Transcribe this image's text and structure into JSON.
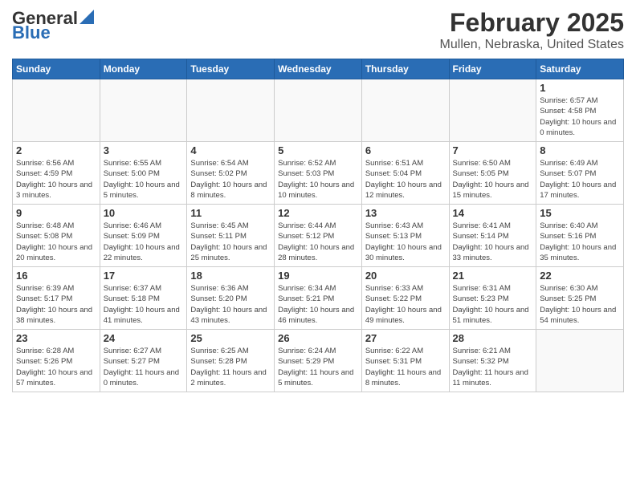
{
  "header": {
    "title": "February 2025",
    "subtitle": "Mullen, Nebraska, United States"
  },
  "days": [
    "Sunday",
    "Monday",
    "Tuesday",
    "Wednesday",
    "Thursday",
    "Friday",
    "Saturday"
  ],
  "weeks": [
    [
      {
        "num": "",
        "info": "",
        "empty": true
      },
      {
        "num": "",
        "info": "",
        "empty": true
      },
      {
        "num": "",
        "info": "",
        "empty": true
      },
      {
        "num": "",
        "info": "",
        "empty": true
      },
      {
        "num": "",
        "info": "",
        "empty": true
      },
      {
        "num": "",
        "info": "",
        "empty": true
      },
      {
        "num": "1",
        "info": "Sunrise: 6:57 AM\nSunset: 4:58 PM\nDaylight: 10 hours\nand 0 minutes.",
        "empty": false
      }
    ],
    [
      {
        "num": "2",
        "info": "Sunrise: 6:56 AM\nSunset: 4:59 PM\nDaylight: 10 hours\nand 3 minutes.",
        "empty": false
      },
      {
        "num": "3",
        "info": "Sunrise: 6:55 AM\nSunset: 5:00 PM\nDaylight: 10 hours\nand 5 minutes.",
        "empty": false
      },
      {
        "num": "4",
        "info": "Sunrise: 6:54 AM\nSunset: 5:02 PM\nDaylight: 10 hours\nand 8 minutes.",
        "empty": false
      },
      {
        "num": "5",
        "info": "Sunrise: 6:52 AM\nSunset: 5:03 PM\nDaylight: 10 hours\nand 10 minutes.",
        "empty": false
      },
      {
        "num": "6",
        "info": "Sunrise: 6:51 AM\nSunset: 5:04 PM\nDaylight: 10 hours\nand 12 minutes.",
        "empty": false
      },
      {
        "num": "7",
        "info": "Sunrise: 6:50 AM\nSunset: 5:05 PM\nDaylight: 10 hours\nand 15 minutes.",
        "empty": false
      },
      {
        "num": "8",
        "info": "Sunrise: 6:49 AM\nSunset: 5:07 PM\nDaylight: 10 hours\nand 17 minutes.",
        "empty": false
      }
    ],
    [
      {
        "num": "9",
        "info": "Sunrise: 6:48 AM\nSunset: 5:08 PM\nDaylight: 10 hours\nand 20 minutes.",
        "empty": false
      },
      {
        "num": "10",
        "info": "Sunrise: 6:46 AM\nSunset: 5:09 PM\nDaylight: 10 hours\nand 22 minutes.",
        "empty": false
      },
      {
        "num": "11",
        "info": "Sunrise: 6:45 AM\nSunset: 5:11 PM\nDaylight: 10 hours\nand 25 minutes.",
        "empty": false
      },
      {
        "num": "12",
        "info": "Sunrise: 6:44 AM\nSunset: 5:12 PM\nDaylight: 10 hours\nand 28 minutes.",
        "empty": false
      },
      {
        "num": "13",
        "info": "Sunrise: 6:43 AM\nSunset: 5:13 PM\nDaylight: 10 hours\nand 30 minutes.",
        "empty": false
      },
      {
        "num": "14",
        "info": "Sunrise: 6:41 AM\nSunset: 5:14 PM\nDaylight: 10 hours\nand 33 minutes.",
        "empty": false
      },
      {
        "num": "15",
        "info": "Sunrise: 6:40 AM\nSunset: 5:16 PM\nDaylight: 10 hours\nand 35 minutes.",
        "empty": false
      }
    ],
    [
      {
        "num": "16",
        "info": "Sunrise: 6:39 AM\nSunset: 5:17 PM\nDaylight: 10 hours\nand 38 minutes.",
        "empty": false
      },
      {
        "num": "17",
        "info": "Sunrise: 6:37 AM\nSunset: 5:18 PM\nDaylight: 10 hours\nand 41 minutes.",
        "empty": false
      },
      {
        "num": "18",
        "info": "Sunrise: 6:36 AM\nSunset: 5:20 PM\nDaylight: 10 hours\nand 43 minutes.",
        "empty": false
      },
      {
        "num": "19",
        "info": "Sunrise: 6:34 AM\nSunset: 5:21 PM\nDaylight: 10 hours\nand 46 minutes.",
        "empty": false
      },
      {
        "num": "20",
        "info": "Sunrise: 6:33 AM\nSunset: 5:22 PM\nDaylight: 10 hours\nand 49 minutes.",
        "empty": false
      },
      {
        "num": "21",
        "info": "Sunrise: 6:31 AM\nSunset: 5:23 PM\nDaylight: 10 hours\nand 51 minutes.",
        "empty": false
      },
      {
        "num": "22",
        "info": "Sunrise: 6:30 AM\nSunset: 5:25 PM\nDaylight: 10 hours\nand 54 minutes.",
        "empty": false
      }
    ],
    [
      {
        "num": "23",
        "info": "Sunrise: 6:28 AM\nSunset: 5:26 PM\nDaylight: 10 hours\nand 57 minutes.",
        "empty": false
      },
      {
        "num": "24",
        "info": "Sunrise: 6:27 AM\nSunset: 5:27 PM\nDaylight: 11 hours\nand 0 minutes.",
        "empty": false
      },
      {
        "num": "25",
        "info": "Sunrise: 6:25 AM\nSunset: 5:28 PM\nDaylight: 11 hours\nand 2 minutes.",
        "empty": false
      },
      {
        "num": "26",
        "info": "Sunrise: 6:24 AM\nSunset: 5:29 PM\nDaylight: 11 hours\nand 5 minutes.",
        "empty": false
      },
      {
        "num": "27",
        "info": "Sunrise: 6:22 AM\nSunset: 5:31 PM\nDaylight: 11 hours\nand 8 minutes.",
        "empty": false
      },
      {
        "num": "28",
        "info": "Sunrise: 6:21 AM\nSunset: 5:32 PM\nDaylight: 11 hours\nand 11 minutes.",
        "empty": false
      },
      {
        "num": "",
        "info": "",
        "empty": true
      }
    ]
  ]
}
